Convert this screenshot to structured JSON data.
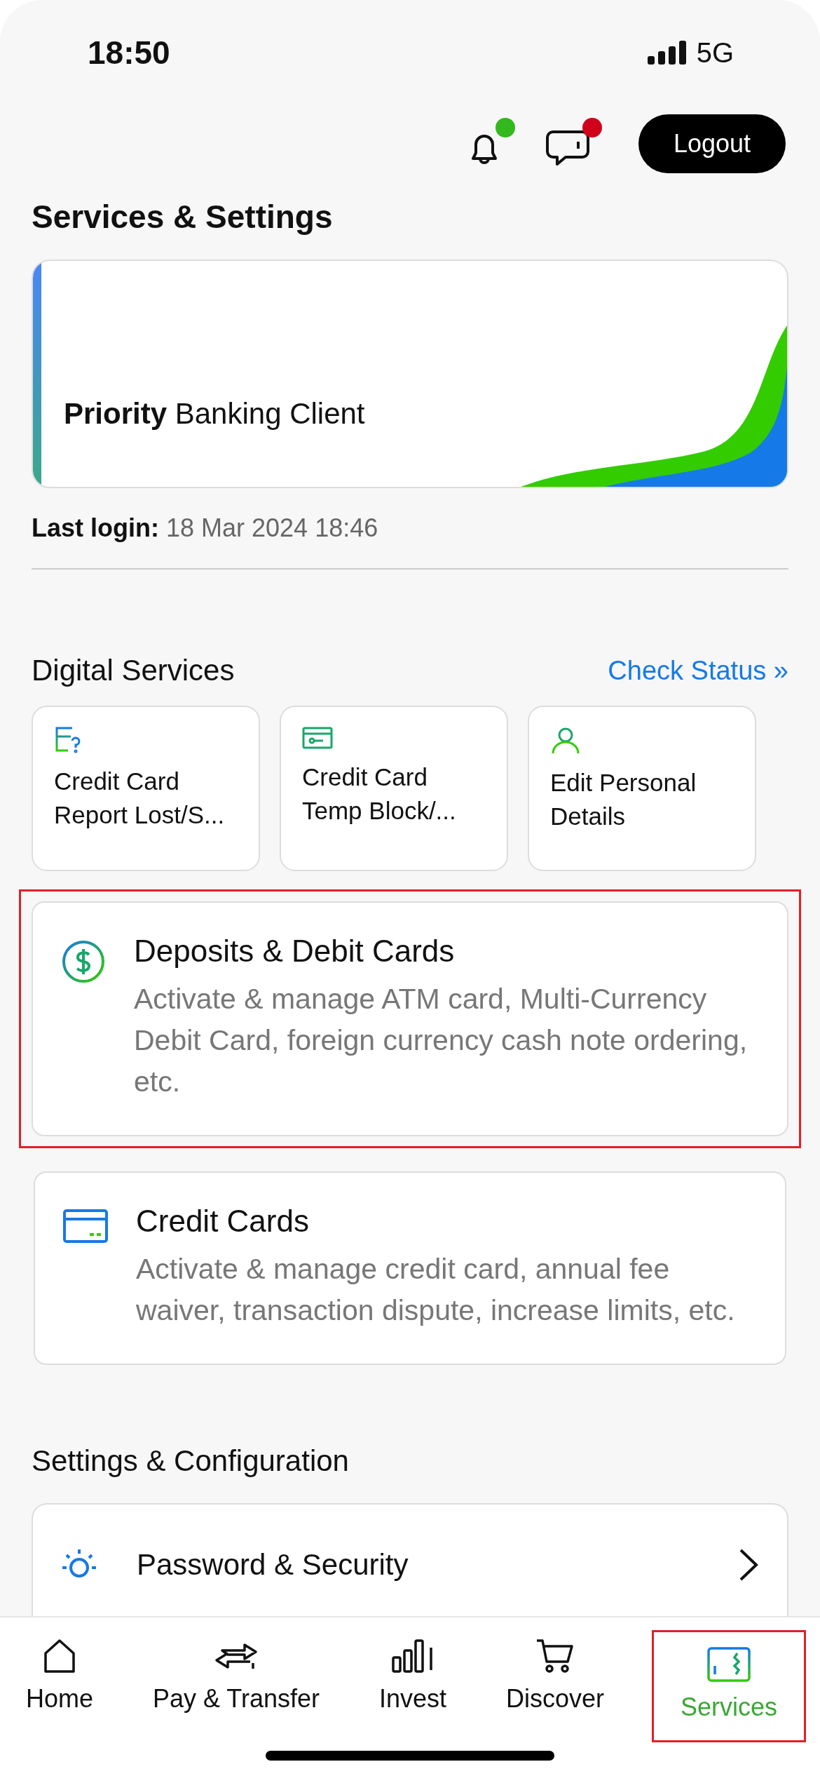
{
  "status_bar": {
    "time": "18:50",
    "network": "5G"
  },
  "header_icons": [
    {
      "kind": "bell",
      "color": "#33b81e"
    },
    {
      "kind": "chat",
      "color": "#d0021b"
    }
  ],
  "logout_button": "Logout",
  "page_title": "Services & Settings",
  "client_card": {
    "tier": "Priority",
    "label": "Banking Client"
  },
  "last_login": {
    "label": "Last login:",
    "value": "18 Mar 2024 18:46"
  },
  "digital_services": {
    "title": "Digital Services",
    "link": "Check Status »",
    "shortcuts": [
      {
        "kind": "card-question",
        "lines": [
          "Credit Card",
          "Report Lost/S..."
        ]
      },
      {
        "kind": "card-key",
        "lines": [
          "Credit Card",
          "Temp Block/..."
        ]
      },
      {
        "kind": "person",
        "lines": [
          "Edit Personal",
          "Details"
        ]
      }
    ]
  },
  "service_cards": [
    {
      "kind": "dollar",
      "title": "Deposits & Debit Cards",
      "description": "Activate & manage ATM card, Multi-Currency Debit Card, foreign currency cash note ordering, etc.",
      "highlighted": true
    },
    {
      "kind": "card",
      "title": "Credit Cards",
      "description": "Activate & manage credit card, annual fee waiver, transaction dispute, increase limits, etc.",
      "highlighted": false
    }
  ],
  "settings": {
    "title": "Settings & Configuration",
    "items": [
      {
        "kind": "sun",
        "label": "Password & Security"
      }
    ]
  },
  "nav": [
    {
      "kind": "home",
      "label": "Home",
      "selected": false,
      "highlighted": false
    },
    {
      "kind": "transfer",
      "label": "Pay & Transfer",
      "selected": false,
      "highlighted": false
    },
    {
      "kind": "invest",
      "label": "Invest",
      "selected": false,
      "highlighted": false
    },
    {
      "kind": "cart",
      "label": "Discover",
      "selected": false,
      "highlighted": false
    },
    {
      "kind": "services",
      "label": "Services",
      "selected": true,
      "highlighted": true
    }
  ]
}
